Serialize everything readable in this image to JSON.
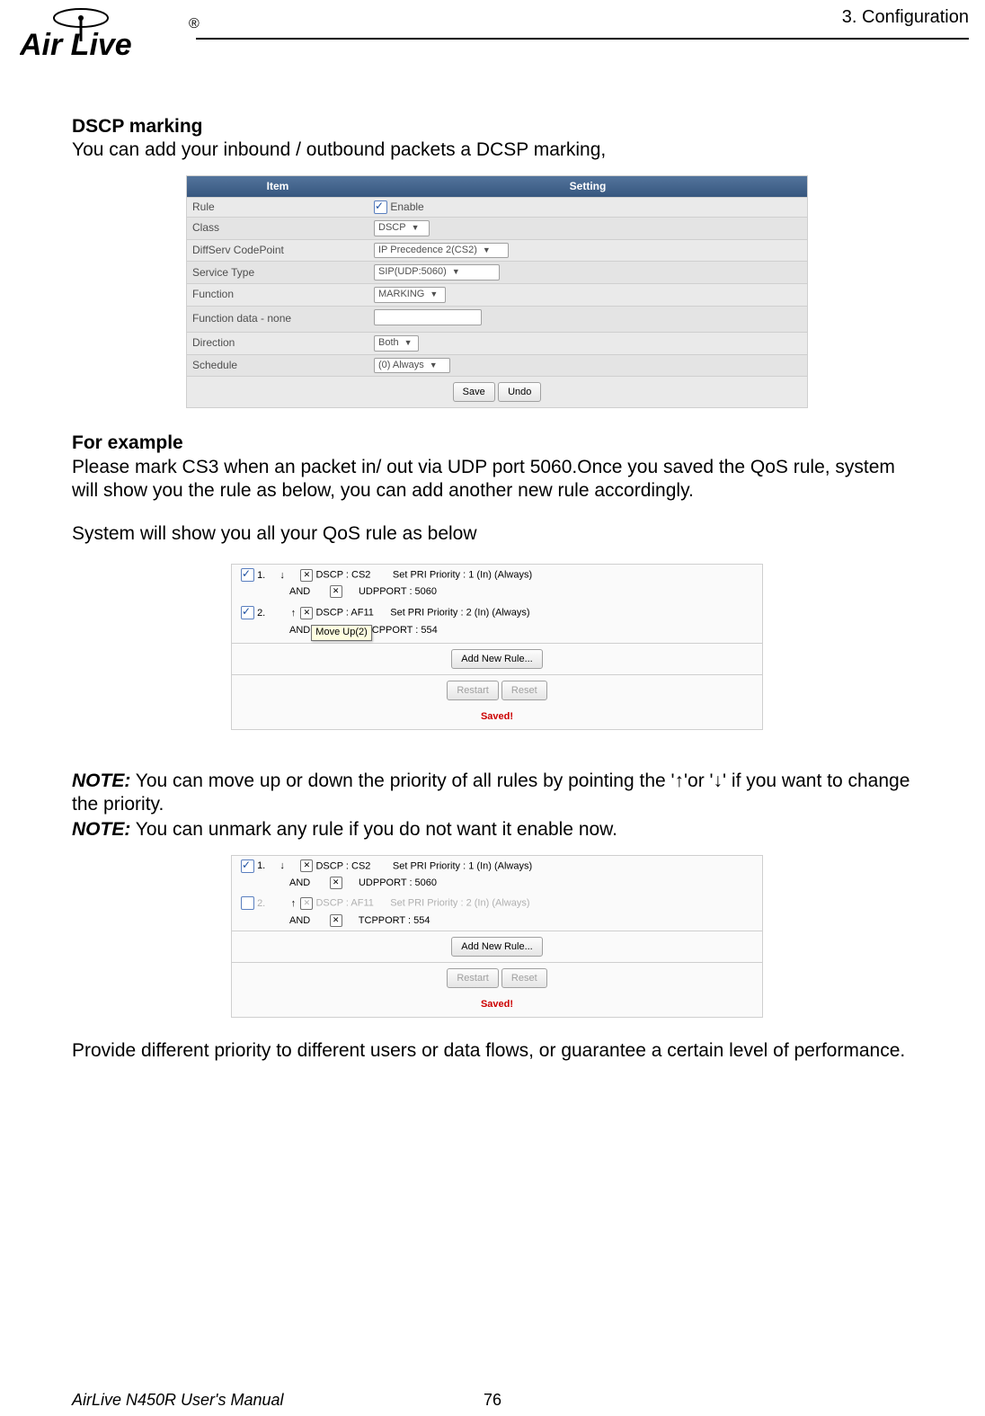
{
  "header": {
    "breadcrumb": "3.  Configuration",
    "brand_text_1": "Air Live",
    "brand_reg": "®"
  },
  "section_dscp": {
    "heading": "DSCP marking",
    "desc": "You can add your inbound / outbound packets a DCSP marking,"
  },
  "table1": {
    "col_item": "Item",
    "col_setting": "Setting",
    "rows": {
      "rule_label": "Rule",
      "rule_enable": "Enable",
      "class_label": "Class",
      "class_value": "DSCP",
      "diffserv_label": "DiffServ CodePoint",
      "diffserv_value": "IP Precedence 2(CS2)",
      "service_label": "Service Type",
      "service_value": "SIP(UDP:5060)",
      "function_label": "Function",
      "function_value": "MARKING",
      "funcdata_label": "Function data - none",
      "direction_label": "Direction",
      "direction_value": "Both",
      "schedule_label": "Schedule",
      "schedule_value": "(0) Always"
    },
    "save": "Save",
    "undo": "Undo"
  },
  "section_example": {
    "heading": "For example",
    "p1": "Please mark CS3 when an packet in/ out via UDP port 5060.Once you saved the QoS rule, system will show you the rule as below, you can add another new rule accordingly.",
    "p2": "System will show you all your QoS rule as below"
  },
  "rulelist1": {
    "r1": {
      "num": "1.",
      "dscp": "DSCP",
      "dscp_val": ": CS2",
      "action": "Set PRI Priority",
      "action_val": ": 1  (In)  (Always)",
      "and": "AND",
      "port": "UDPPORT",
      "port_val": ": 5060"
    },
    "r2": {
      "num": "2.",
      "dscp": "DSCP",
      "dscp_val": ": AF11",
      "action": "Set PRI Priority",
      "action_val": ": 2  (In)  (Always)",
      "and": "AND",
      "port": "CPPORT",
      "port_val": ": 554",
      "tooltip": "Move Up(2)"
    },
    "add": "Add New Rule...",
    "restart": "Restart",
    "reset": "Reset",
    "saved": "Saved!"
  },
  "notes": {
    "n1_label": "NOTE:",
    "n1_body": " You can move up or down the priority of all rules by pointing the '↑'or '↓' if you want to change the priority.",
    "n2_label": "NOTE:",
    "n2_body": " You can unmark any rule if you do not want it enable now."
  },
  "rulelist2": {
    "r1": {
      "num": "1.",
      "dscp": "DSCP",
      "dscp_val": ": CS2",
      "action": "Set PRI Priority",
      "action_val": ": 1  (In)  (Always)",
      "and": "AND",
      "port": "UDPPORT",
      "port_val": ": 5060"
    },
    "r2": {
      "num": "2.",
      "dscp": "DSCP",
      "dscp_val": ": AF11",
      "action": "Set PRI Priority",
      "action_val": ": 2  (In)  (Always)",
      "and": "AND",
      "port": "TCPPORT",
      "port_val": ": 554"
    },
    "add": "Add New Rule...",
    "restart": "Restart",
    "reset": "Reset",
    "saved": "Saved!"
  },
  "closing": "Provide different priority to different users or data flows, or guarantee a certain level of performance.",
  "footer": {
    "manual": "AirLive N450R User's Manual",
    "page": "76"
  }
}
